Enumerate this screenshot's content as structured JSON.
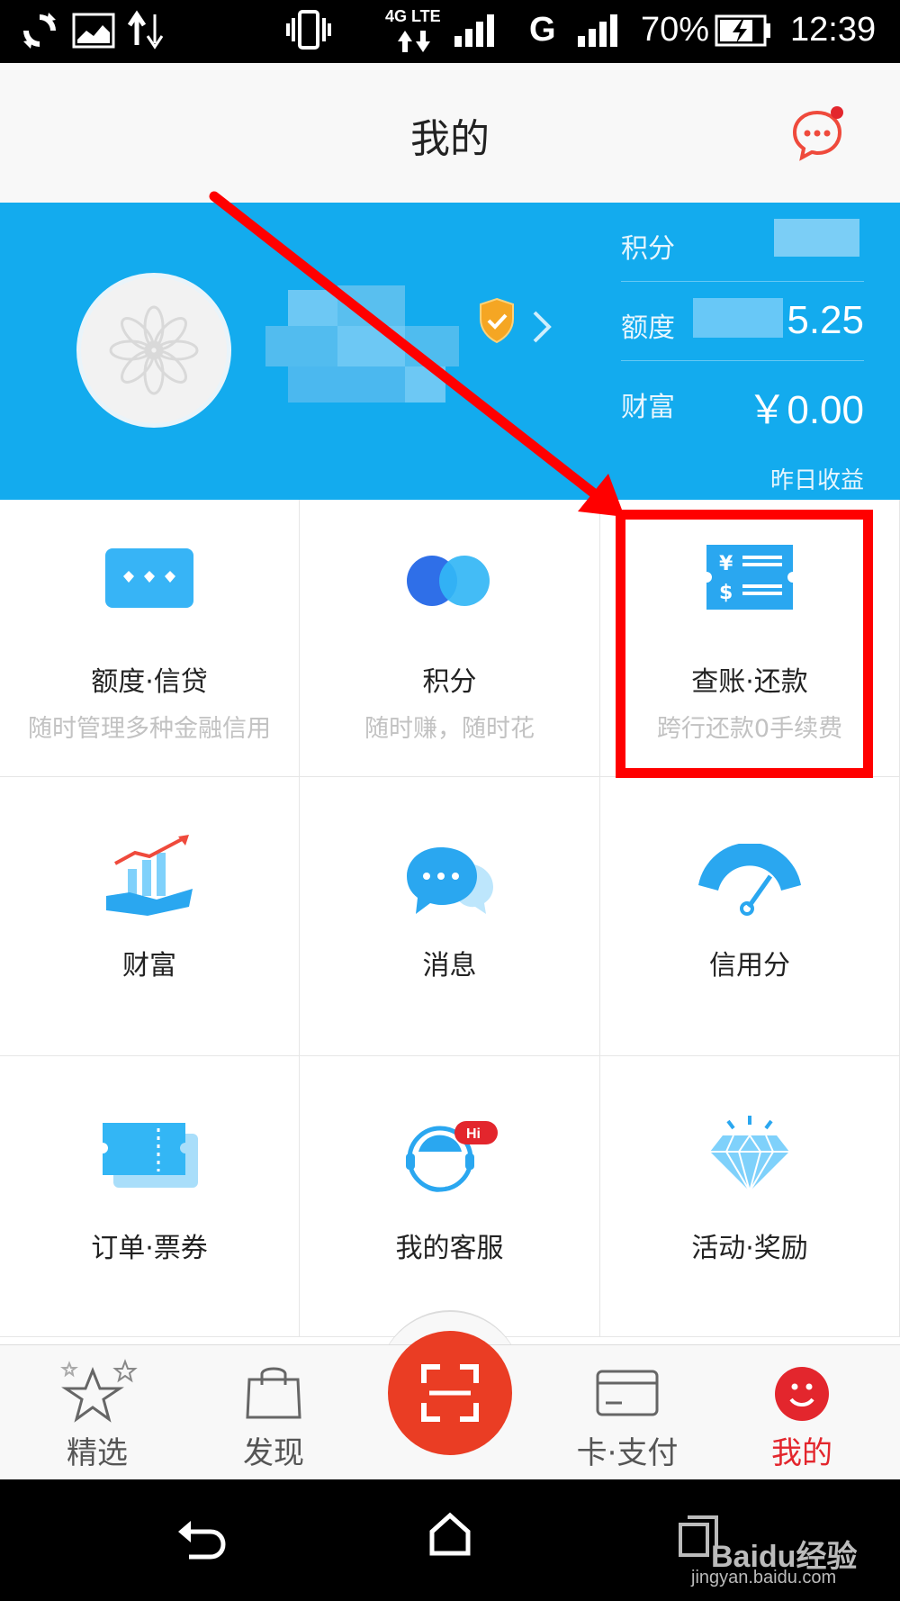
{
  "status_bar": {
    "network": "4G LTE",
    "battery_percent": "70%",
    "time": "12:39",
    "carrier_char": "G"
  },
  "header": {
    "title": "我的"
  },
  "profile": {
    "stats": [
      {
        "label": "积分",
        "value": ""
      },
      {
        "label": "额度",
        "value": "5.25"
      },
      {
        "label": "财富",
        "value": "￥0.00"
      }
    ],
    "wealth_sub": "昨日收益"
  },
  "grid": [
    {
      "title": "额度·信贷",
      "subtitle": "随时管理多种金融信用",
      "icon": "credit-card-icon"
    },
    {
      "title": "积分",
      "subtitle": "随时赚，随时花",
      "icon": "points-circles-icon"
    },
    {
      "title": "查账·还款",
      "subtitle": "跨行还款0手续费",
      "icon": "bill-icon"
    },
    {
      "title": "财富",
      "subtitle": "",
      "icon": "wealth-growth-icon"
    },
    {
      "title": "消息",
      "subtitle": "",
      "icon": "chat-bubble-icon"
    },
    {
      "title": "信用分",
      "subtitle": "",
      "icon": "gauge-icon"
    },
    {
      "title": "订单·票券",
      "subtitle": "",
      "icon": "ticket-icon"
    },
    {
      "title": "我的客服",
      "subtitle": "",
      "icon": "customer-service-icon",
      "badge": "Hi"
    },
    {
      "title": "活动·奖励",
      "subtitle": "",
      "icon": "diamond-icon"
    }
  ],
  "tabs": [
    {
      "label": "精选",
      "icon": "star-icon",
      "active": false
    },
    {
      "label": "发现",
      "icon": "bag-icon",
      "active": false
    },
    {
      "label": "卡·支付",
      "icon": "card-icon",
      "active": false
    },
    {
      "label": "我的",
      "icon": "smile-icon",
      "active": true
    }
  ],
  "watermark": {
    "brand": "Baidu经验",
    "url": "jingyan.baidu.com"
  },
  "colors": {
    "banner": "#13abee",
    "accent_red": "#e3262d",
    "annotation_red": "#ff0000"
  }
}
